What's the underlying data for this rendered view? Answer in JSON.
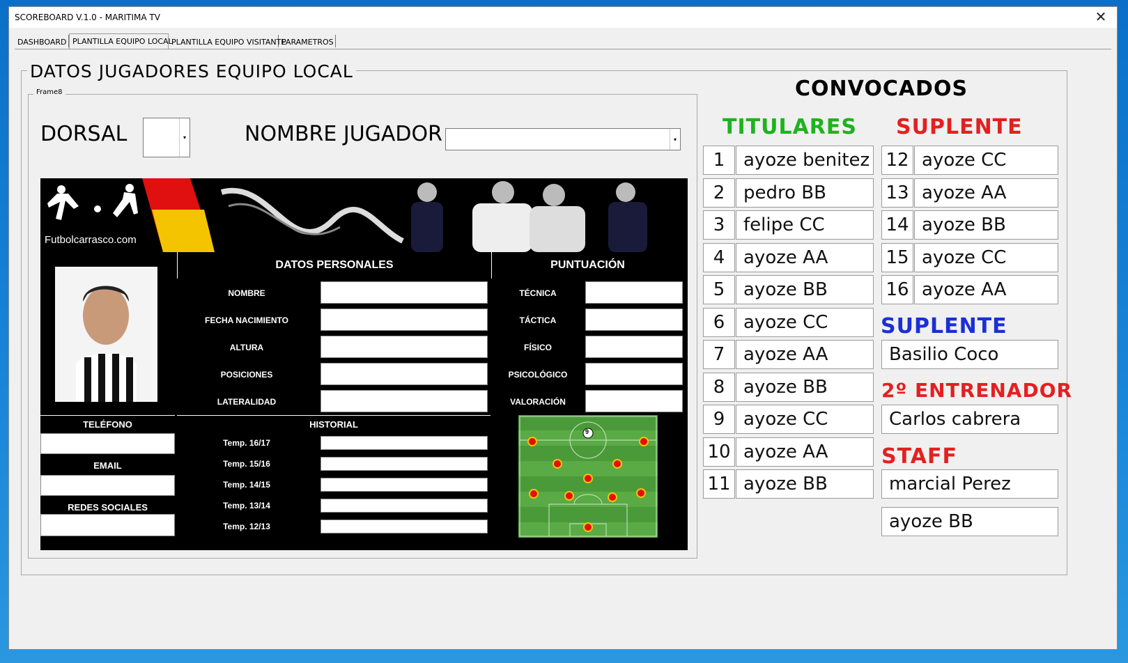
{
  "window": {
    "title": "SCOREBOARD V.1.0 - MARITIMA TV",
    "close": "✕"
  },
  "tabs": [
    "DASHBOARD",
    "PLANTILLA EQUIPO LOCAL",
    "PLANTILLA EQUIPO VISITANTE",
    "PARAMETROS"
  ],
  "active_tab": "PLANTILLA EQUIPO LOCAL",
  "main_frame": {
    "title": "DATOS JUGADORES EQUIPO LOCAL"
  },
  "inner_frame": {
    "caption": "Frame8"
  },
  "dorsal": {
    "label": "DORSAL",
    "value": ""
  },
  "nombre_jugador": {
    "label": "NOMBRE JUGADOR",
    "value": ""
  },
  "banner": {
    "site": "Futbolcarrasco.com"
  },
  "datos_personales": {
    "header": "DATOS PERSONALES",
    "fields": [
      "NOMBRE",
      "FECHA NACIMIENTO",
      "ALTURA",
      "POSICIONES",
      "LATERALIDAD"
    ]
  },
  "puntuacion": {
    "header": "PUNTUACIÓN",
    "fields": [
      "TÉCNICA",
      "TÁCTICA",
      "FÍSICO",
      "PSICOLÓGICO",
      "VALORACIÓN"
    ]
  },
  "contacto": {
    "telefono": "TELÉFONO",
    "email": "EMAIL",
    "redes": "REDES SOCIALES"
  },
  "historial": {
    "header": "HISTORIAL",
    "seasons": [
      "Temp. 16/17",
      "Temp. 15/16",
      "Temp. 14/15",
      "Temp. 13/14",
      "Temp. 12/13"
    ]
  },
  "pitch": {
    "badge": "9"
  },
  "convocados": {
    "title": "CONVOCADOS",
    "titulares_title": "TITULARES",
    "suplente_title": "SUPLENTE",
    "titulares": [
      {
        "num": "1",
        "name": "ayoze benitez"
      },
      {
        "num": "2",
        "name": "pedro BB"
      },
      {
        "num": "3",
        "name": "felipe CC"
      },
      {
        "num": "4",
        "name": "ayoze AA"
      },
      {
        "num": "5",
        "name": "ayoze BB"
      },
      {
        "num": "6",
        "name": "ayoze CC"
      },
      {
        "num": "7",
        "name": "ayoze AA"
      },
      {
        "num": "8",
        "name": "ayoze BB"
      },
      {
        "num": "9",
        "name": "ayoze CC"
      },
      {
        "num": "10",
        "name": "ayoze AA"
      },
      {
        "num": "11",
        "name": "ayoze BB"
      }
    ],
    "suplentes": [
      {
        "num": "12",
        "name": "ayoze CC"
      },
      {
        "num": "13",
        "name": "ayoze AA"
      },
      {
        "num": "14",
        "name": "ayoze BB"
      },
      {
        "num": "15",
        "name": "ayoze CC"
      },
      {
        "num": "16",
        "name": "ayoze AA"
      }
    ],
    "suplente2_title": "SUPLENTE",
    "suplente2_name": "Basilio  Coco",
    "entrenador_title": "2º ENTRENADOR",
    "entrenador_name": "Carlos cabrera",
    "staff_title": "STAFF",
    "staff": [
      "marcial Perez",
      "ayoze BB"
    ]
  },
  "colors": {
    "green": "#1db31d",
    "red": "#e32020",
    "blue": "#1a2fd6"
  }
}
